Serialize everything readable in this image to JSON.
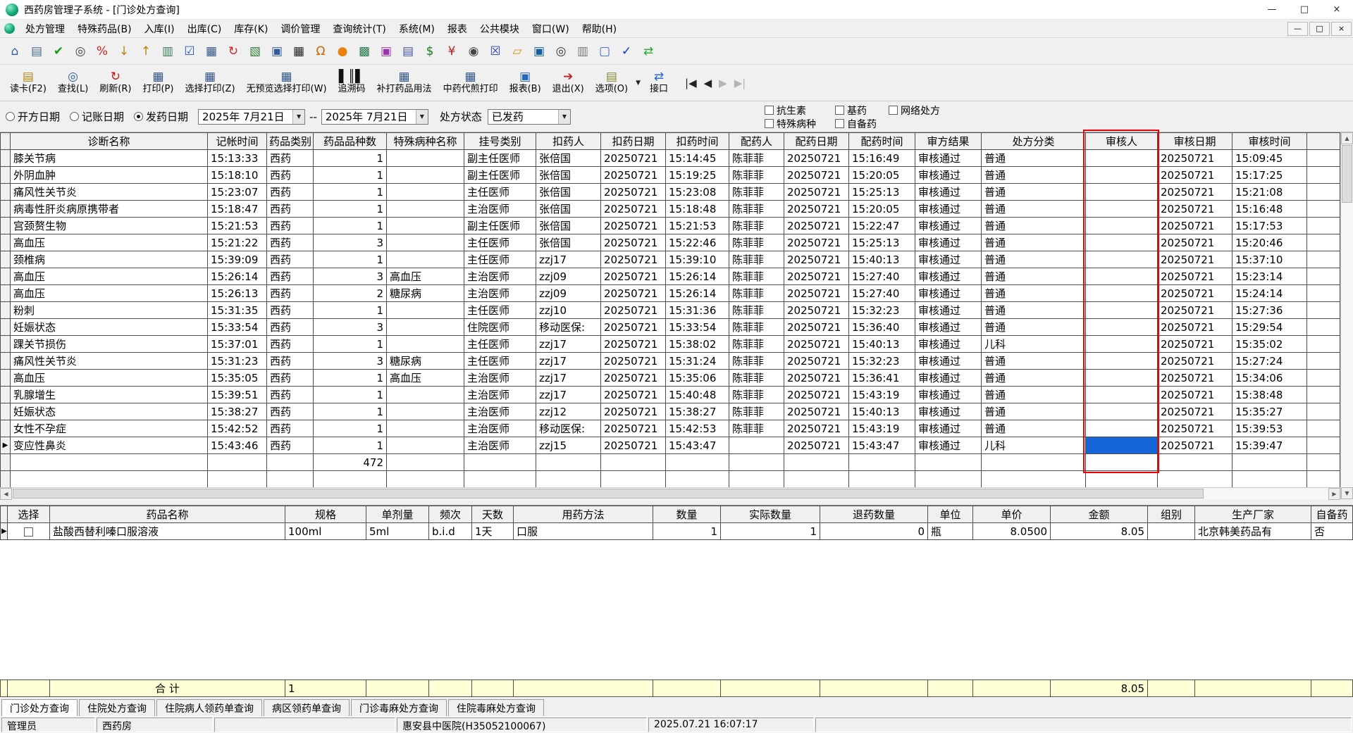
{
  "window": {
    "title": "西药房管理子系统 - [门诊处方查询]",
    "controls": {
      "minimize": "—",
      "maximize": "□",
      "close": "×"
    },
    "mdi_controls": {
      "minimize": "—",
      "restore": "□",
      "close": "×"
    }
  },
  "menu": {
    "items": [
      "处方管理",
      "特殊药品(B)",
      "入库(I)",
      "出库(C)",
      "库存(K)",
      "调价管理",
      "查询统计(T)",
      "系统(M)",
      "报表",
      "公共模块",
      "窗口(W)",
      "帮助(H)"
    ]
  },
  "toolbar_icons": [
    {
      "name": "home-icon",
      "glyph": "⌂",
      "color": "#2d5fa0"
    },
    {
      "name": "card-reader-icon",
      "glyph": "▤",
      "color": "#4a6d8c"
    },
    {
      "name": "audit-approve-icon",
      "glyph": "✔",
      "color": "#189a18"
    },
    {
      "name": "binoculars-icon",
      "glyph": "◎",
      "color": "#444444"
    },
    {
      "name": "discount-icon",
      "glyph": "%",
      "color": "#cc2222"
    },
    {
      "name": "stock-in-icon",
      "glyph": "↓",
      "color": "#b8860b"
    },
    {
      "name": "stock-out-icon",
      "glyph": "↑",
      "color": "#b8860b"
    },
    {
      "name": "invoice-icon",
      "glyph": "▥",
      "color": "#3a7a5a"
    },
    {
      "name": "select-check-icon",
      "glyph": "☑",
      "color": "#2255cc"
    },
    {
      "name": "print-icon",
      "glyph": "▦",
      "color": "#33568c"
    },
    {
      "name": "refresh-icon",
      "glyph": "↻",
      "color": "#cc2222"
    },
    {
      "name": "chart-icon",
      "glyph": "▧",
      "color": "#2e7d32"
    },
    {
      "name": "monitor-icon",
      "glyph": "▣",
      "color": "#335a9c"
    },
    {
      "name": "grid-icon",
      "glyph": "▦",
      "color": "#222222"
    },
    {
      "name": "bell-icon",
      "glyph": "Ω",
      "color": "#cc6600"
    },
    {
      "name": "pill-icon",
      "glyph": "●",
      "color": "#e8820c"
    },
    {
      "name": "box-icon",
      "glyph": "▩",
      "color": "#2a7a4a"
    },
    {
      "name": "gift-icon",
      "glyph": "▣",
      "color": "#9933aa"
    },
    {
      "name": "print2-icon",
      "glyph": "▤",
      "color": "#4455aa"
    },
    {
      "name": "money-icon",
      "glyph": "$",
      "color": "#1a7a1a"
    },
    {
      "name": "rmb-icon",
      "glyph": "¥",
      "color": "#aa2222"
    },
    {
      "name": "search-icon",
      "glyph": "◉",
      "color": "#444444"
    },
    {
      "name": "close-box-icon",
      "glyph": "☒",
      "color": "#2244bb"
    },
    {
      "name": "folder-icon",
      "glyph": "▱",
      "color": "#cc9900"
    },
    {
      "name": "save-icon",
      "glyph": "▣",
      "color": "#155fa0"
    },
    {
      "name": "zoom-icon",
      "glyph": "◎",
      "color": "#333333"
    },
    {
      "name": "layout-icon",
      "glyph": "▥",
      "color": "#777777"
    },
    {
      "name": "window-icon",
      "glyph": "▢",
      "color": "#3366cc"
    },
    {
      "name": "check2-icon",
      "glyph": "✓",
      "color": "#1133cc"
    },
    {
      "name": "sync-icon",
      "glyph": "⇄",
      "color": "#22aa22"
    }
  ],
  "toolbar_buttons": [
    {
      "name": "read-card-button",
      "label": "读卡(F2)",
      "glyph": "▤",
      "color": "#b8860b"
    },
    {
      "name": "find-button",
      "label": "查找(L)",
      "glyph": "◎",
      "color": "#2d5fa0"
    },
    {
      "name": "refresh-button",
      "label": "刷新(R)",
      "glyph": "↻",
      "color": "#cc1111"
    },
    {
      "name": "print-button",
      "label": "打印(P)",
      "glyph": "▦",
      "color": "#33568c"
    },
    {
      "name": "select-print-button",
      "label": "选择打印(Z)",
      "glyph": "▦",
      "color": "#33568c"
    },
    {
      "name": "no-preview-select-print-button",
      "label": "无预览选择打印(W)",
      "glyph": "▦",
      "color": "#33568c"
    },
    {
      "name": "trace-code-button",
      "label": "追溯码",
      "glyph": "▌║▌",
      "color": "#111111"
    },
    {
      "name": "reprint-drug-usage-button",
      "label": "补打药品用法",
      "glyph": "▦",
      "color": "#33568c"
    },
    {
      "name": "tcm-decoction-print-button",
      "label": "中药代煎打印",
      "glyph": "▦",
      "color": "#33568c"
    },
    {
      "name": "report-button",
      "label": "报表(B)",
      "glyph": "▣",
      "color": "#2266bb"
    },
    {
      "name": "exit-button",
      "label": "退出(X)",
      "glyph": "➔",
      "color": "#bb2222"
    },
    {
      "name": "options-button",
      "label": "选项(O)",
      "glyph": "▤",
      "color": "#888833"
    }
  ],
  "toolbar2_extra": {
    "dropdown_glyph": "▼",
    "interface_label": "接口",
    "interface_icon_glyph": "⇄"
  },
  "record_nav": [
    {
      "name": "nav-first-button",
      "glyph": "|◀",
      "disabled": false
    },
    {
      "name": "nav-prev-button",
      "glyph": "◀",
      "disabled": false
    },
    {
      "name": "nav-next-button",
      "glyph": "▶",
      "disabled": true
    },
    {
      "name": "nav-last-button",
      "glyph": "▶|",
      "disabled": true
    }
  ],
  "filters": {
    "radios": [
      {
        "label": "开方日期",
        "selected": false
      },
      {
        "label": "记账日期",
        "selected": false
      },
      {
        "label": "发药日期",
        "selected": true
      }
    ],
    "date_from": "2025年 7月21日",
    "date_separator": "--",
    "date_to": "2025年 7月21日",
    "status_label": "处方状态",
    "status_value": "已发药",
    "combo_arrow": "▼",
    "checkboxes": [
      {
        "label": "抗生素",
        "checked": false
      },
      {
        "label": "基药",
        "checked": false
      },
      {
        "label": "网络处方",
        "checked": false
      },
      {
        "label": "特殊病种",
        "checked": false
      },
      {
        "label": "自备药",
        "checked": false
      }
    ]
  },
  "main_table": {
    "columns": [
      "诊断名称",
      "记帐时间",
      "药品类别",
      "药品品种数",
      "特殊病种名称",
      "挂号类别",
      "扣药人",
      "扣药日期",
      "扣药时间",
      "配药人",
      "配药日期",
      "配药时间",
      "审方结果",
      "处方分类",
      "审核人",
      "审核日期",
      "审核时间"
    ],
    "marker_row": 17,
    "selection": {
      "row": 17,
      "col": 14
    },
    "rows": [
      [
        "膝关节病",
        "15:13:33",
        "西药",
        "1",
        "",
        "副主任医师",
        "张倍国",
        "20250721",
        "15:14:45",
        "陈菲菲",
        "20250721",
        "15:16:49",
        "审核通过",
        "普通",
        "",
        "20250721",
        "15:09:45"
      ],
      [
        "外阴血肿",
        "15:18:10",
        "西药",
        "1",
        "",
        "副主任医师",
        "张倍国",
        "20250721",
        "15:19:25",
        "陈菲菲",
        "20250721",
        "15:20:05",
        "审核通过",
        "普通",
        "",
        "20250721",
        "15:17:25"
      ],
      [
        "痛风性关节炎",
        "15:23:07",
        "西药",
        "1",
        "",
        "主任医师",
        "张倍国",
        "20250721",
        "15:23:08",
        "陈菲菲",
        "20250721",
        "15:25:13",
        "审核通过",
        "普通",
        "",
        "20250721",
        "15:21:08"
      ],
      [
        "病毒性肝炎病原携带者",
        "15:18:47",
        "西药",
        "1",
        "",
        "主治医师",
        "张倍国",
        "20250721",
        "15:18:48",
        "陈菲菲",
        "20250721",
        "15:20:05",
        "审核通过",
        "普通",
        "",
        "20250721",
        "15:16:48"
      ],
      [
        "宫颈赘生物",
        "15:21:53",
        "西药",
        "1",
        "",
        "副主任医师",
        "张倍国",
        "20250721",
        "15:21:53",
        "陈菲菲",
        "20250721",
        "15:22:47",
        "审核通过",
        "普通",
        "",
        "20250721",
        "15:17:53"
      ],
      [
        "高血压",
        "15:21:22",
        "西药",
        "3",
        "",
        "主任医师",
        "张倍国",
        "20250721",
        "15:22:46",
        "陈菲菲",
        "20250721",
        "15:25:13",
        "审核通过",
        "普通",
        "",
        "20250721",
        "15:20:46"
      ],
      [
        "颈椎病",
        "15:39:09",
        "西药",
        "1",
        "",
        "主任医师",
        "zzj17",
        "20250721",
        "15:39:10",
        "陈菲菲",
        "20250721",
        "15:40:13",
        "审核通过",
        "普通",
        "",
        "20250721",
        "15:37:10"
      ],
      [
        "高血压",
        "15:26:14",
        "西药",
        "3",
        "高血压",
        "主治医师",
        "zzj09",
        "20250721",
        "15:26:14",
        "陈菲菲",
        "20250721",
        "15:27:40",
        "审核通过",
        "普通",
        "",
        "20250721",
        "15:23:14"
      ],
      [
        "高血压",
        "15:26:13",
        "西药",
        "2",
        "糖尿病",
        "主治医师",
        "zzj09",
        "20250721",
        "15:26:14",
        "陈菲菲",
        "20250721",
        "15:27:40",
        "审核通过",
        "普通",
        "",
        "20250721",
        "15:24:14"
      ],
      [
        "粉刺",
        "15:31:35",
        "西药",
        "1",
        "",
        "主任医师",
        "zzj10",
        "20250721",
        "15:31:36",
        "陈菲菲",
        "20250721",
        "15:32:23",
        "审核通过",
        "普通",
        "",
        "20250721",
        "15:27:36"
      ],
      [
        "妊娠状态",
        "15:33:54",
        "西药",
        "3",
        "",
        "住院医师",
        "移动医保:",
        "20250721",
        "15:33:54",
        "陈菲菲",
        "20250721",
        "15:36:40",
        "审核通过",
        "普通",
        "",
        "20250721",
        "15:29:54"
      ],
      [
        "踝关节损伤",
        "15:37:01",
        "西药",
        "1",
        "",
        "主任医师",
        "zzj17",
        "20250721",
        "15:38:02",
        "陈菲菲",
        "20250721",
        "15:40:13",
        "审核通过",
        "儿科",
        "",
        "20250721",
        "15:35:02"
      ],
      [
        "痛风性关节炎",
        "15:31:23",
        "西药",
        "3",
        "糖尿病",
        "主任医师",
        "zzj17",
        "20250721",
        "15:31:24",
        "陈菲菲",
        "20250721",
        "15:32:23",
        "审核通过",
        "普通",
        "",
        "20250721",
        "15:27:24"
      ],
      [
        "高血压",
        "15:35:05",
        "西药",
        "1",
        "高血压",
        "主治医师",
        "zzj17",
        "20250721",
        "15:35:06",
        "陈菲菲",
        "20250721",
        "15:36:41",
        "审核通过",
        "普通",
        "",
        "20250721",
        "15:34:06"
      ],
      [
        "乳腺增生",
        "15:39:51",
        "西药",
        "1",
        "",
        "主治医师",
        "zzj17",
        "20250721",
        "15:40:48",
        "陈菲菲",
        "20250721",
        "15:43:19",
        "审核通过",
        "普通",
        "",
        "20250721",
        "15:38:48"
      ],
      [
        "妊娠状态",
        "15:38:27",
        "西药",
        "1",
        "",
        "主治医师",
        "zzj12",
        "20250721",
        "15:38:27",
        "陈菲菲",
        "20250721",
        "15:40:13",
        "审核通过",
        "普通",
        "",
        "20250721",
        "15:35:27"
      ],
      [
        "女性不孕症",
        "15:42:52",
        "西药",
        "1",
        "",
        "主治医师",
        "移动医保:",
        "20250721",
        "15:42:53",
        "陈菲菲",
        "20250721",
        "15:43:19",
        "审核通过",
        "普通",
        "",
        "20250721",
        "15:39:53"
      ],
      [
        "变应性鼻炎",
        "15:43:46",
        "西药",
        "1",
        "",
        "主治医师",
        "zzj15",
        "20250721",
        "15:43:47",
        "",
        "20250721",
        "15:43:47",
        "审核通过",
        "儿科",
        "",
        "20250721",
        "15:39:47"
      ],
      [
        "",
        "",
        "",
        "472",
        "",
        "",
        "",
        "",
        "",
        "",
        "",
        "",
        "",
        "",
        "",
        "",
        ""
      ]
    ]
  },
  "detail_table": {
    "columns": [
      "选择",
      "药品名称",
      "规格",
      "单剂量",
      "频次",
      "天数",
      "用药方法",
      "数量",
      "实际数量",
      "退药数量",
      "单位",
      "单价",
      "金额",
      "组别",
      "生产厂家",
      "自备药"
    ],
    "marker_row": 0,
    "rows": [
      [
        "",
        "盐酸西替利嗪口服溶液",
        "100ml",
        "5ml",
        "b.i.d",
        "1天",
        "口服",
        "1",
        "1",
        "0",
        "瓶",
        "8.0500",
        "8.05",
        "",
        "北京韩美药品有",
        "否"
      ]
    ],
    "summary_cells": [
      "",
      "",
      "合  计",
      "1",
      "",
      "",
      "",
      "",
      "",
      "",
      "",
      "",
      "",
      "8.05",
      "",
      "",
      ""
    ]
  },
  "bottom_tabs": [
    {
      "label": "门诊处方查询",
      "active": true
    },
    {
      "label": "住院处方查询",
      "active": false
    },
    {
      "label": "住院病人领药单查询",
      "active": false
    },
    {
      "label": "病区领药单查询",
      "active": false
    },
    {
      "label": "门诊毒麻处方查询",
      "active": false
    },
    {
      "label": "住院毒麻处方查询",
      "active": false
    }
  ],
  "scrollbar": {
    "up": "▲",
    "down": "▼",
    "left": "◀",
    "right": "▶"
  },
  "statusbar": {
    "user": "管理员",
    "pharmacy": "西药房",
    "hospital": "惠安县中医院(H35052100067)",
    "datetime": "2025.07.21 16:07:17"
  }
}
